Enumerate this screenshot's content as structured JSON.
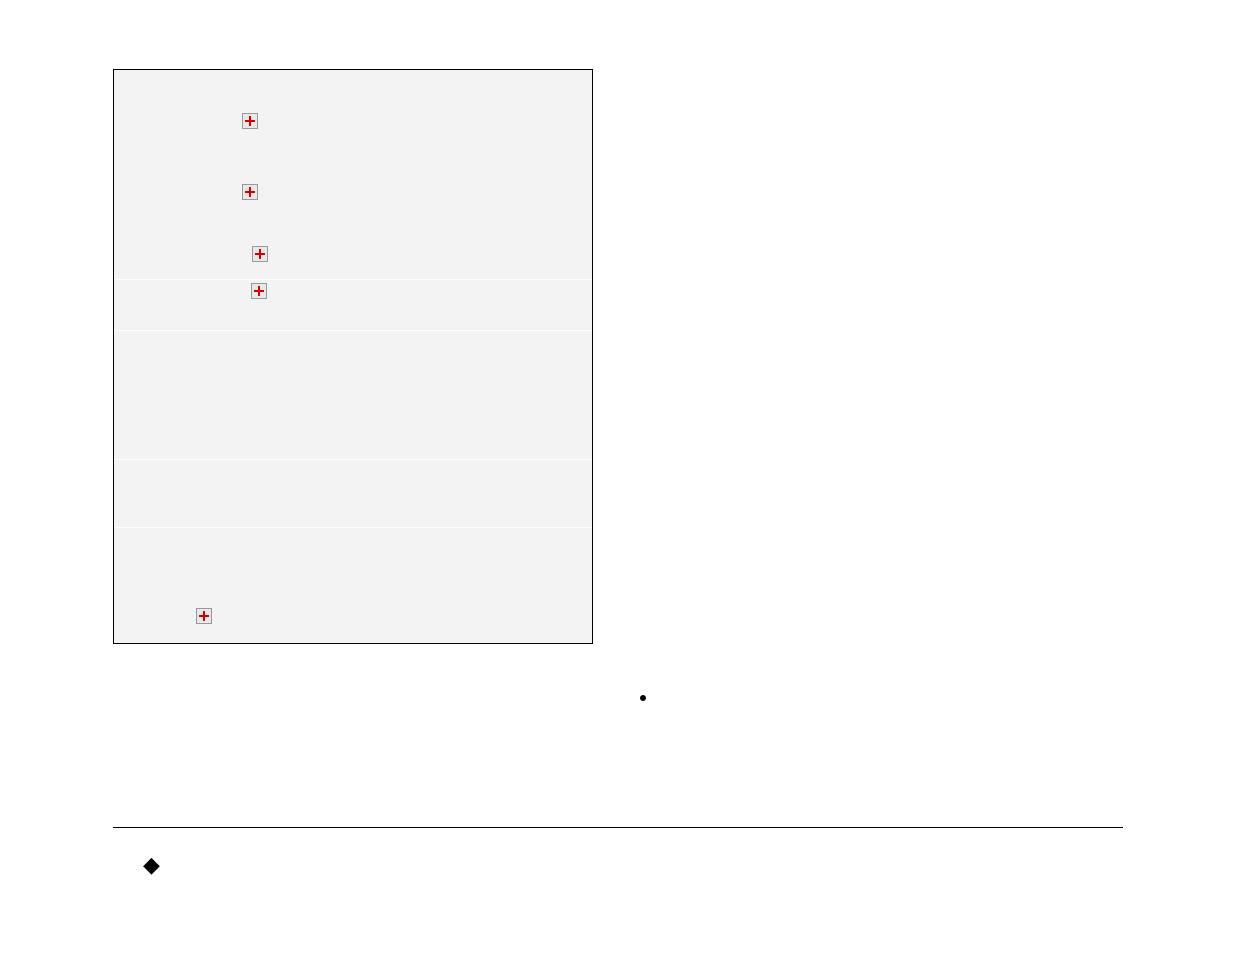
{
  "icons": {
    "plus": "plus-icon",
    "dot": "bullet-dot",
    "diamond": "diamond-bullet"
  },
  "table": {
    "rows": 6
  }
}
